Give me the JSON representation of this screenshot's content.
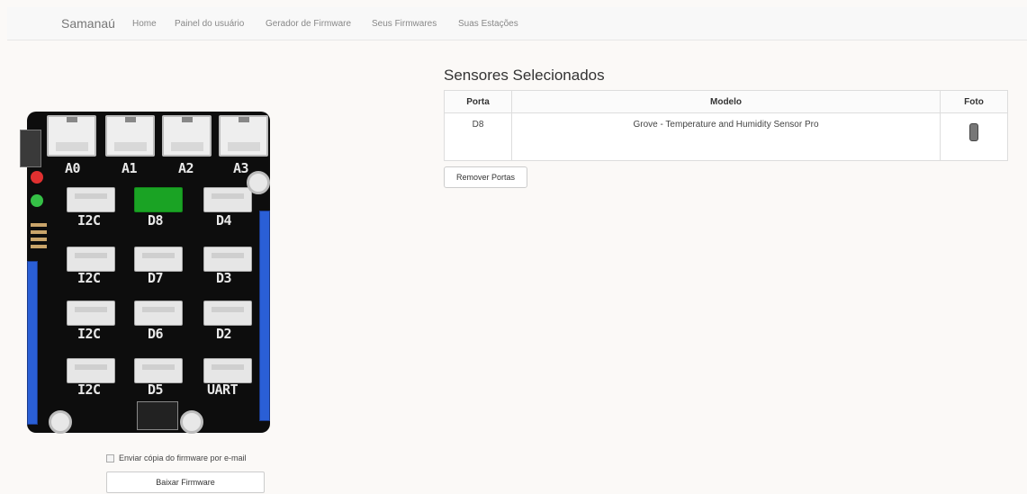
{
  "nav": {
    "brand": "Samanaú",
    "items": [
      {
        "label": "Home"
      },
      {
        "label": "Painel do usuário"
      },
      {
        "label": "Gerador de Firmware"
      },
      {
        "label": "Seus Firmwares"
      },
      {
        "label": "Suas Estações"
      }
    ]
  },
  "board": {
    "top_ports": [
      "A0",
      "A1",
      "A2",
      "A3"
    ],
    "grid_ports": [
      "I2C",
      "D8",
      "D4",
      "I2C",
      "D7",
      "D3",
      "I2C",
      "D6",
      "D2",
      "I2C",
      "D5",
      "UART"
    ],
    "selected_port": "D8",
    "selected_color": "#1aa324"
  },
  "email_checkbox": {
    "label": "Enviar cópia do firmware por e-mail",
    "checked": false
  },
  "download_button": {
    "label": "Baixar Firmware"
  },
  "selected_sensors": {
    "title": "Sensores Selecionados",
    "columns": [
      "Porta",
      "Modelo",
      "Foto"
    ],
    "rows": [
      {
        "porta": "D8",
        "modelo": "Grove - Temperature and Humidity Sensor Pro",
        "foto_icon": "sensor-thumbnail-icon"
      }
    ]
  },
  "remove_button": {
    "label": "Remover Portas"
  }
}
